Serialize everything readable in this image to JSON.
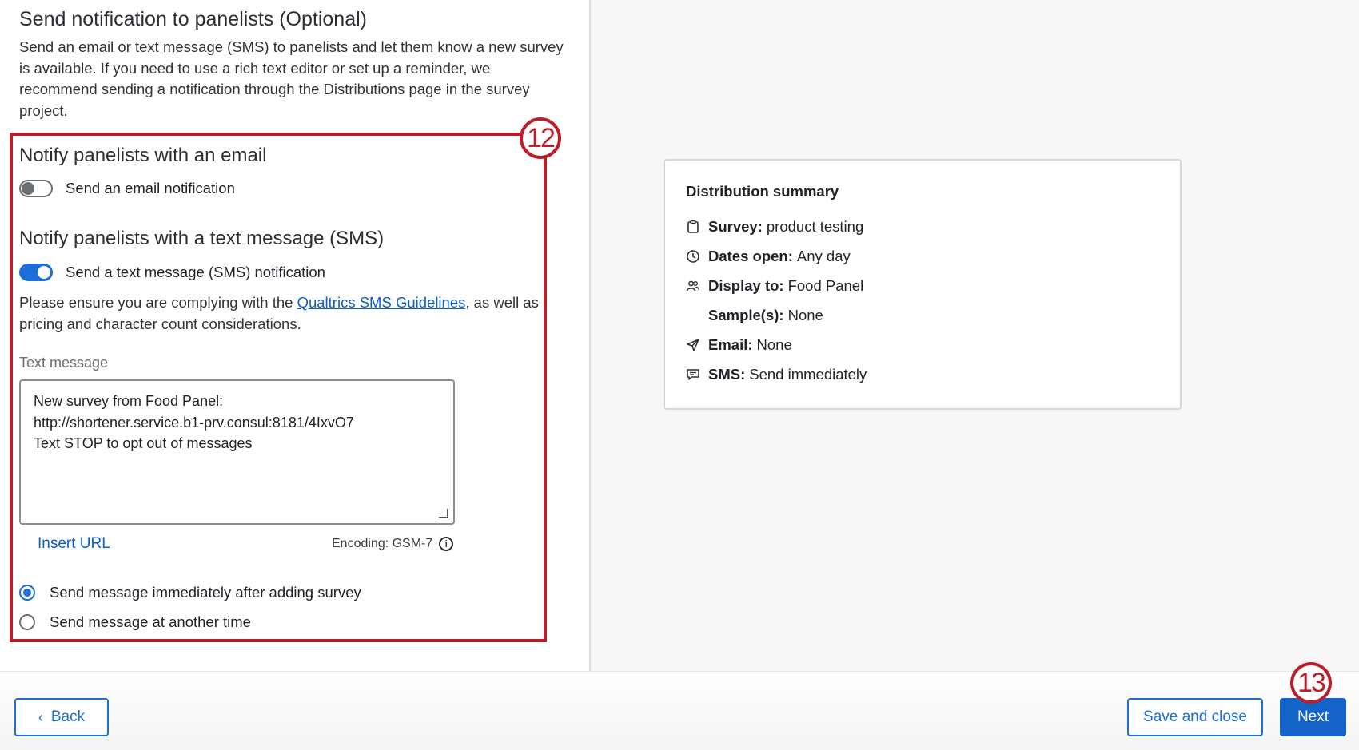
{
  "notification": {
    "title": "Send notification to panelists (Optional)",
    "description": "Send an email or text message (SMS) to panelists and let them know a new survey is available. If you need to use a rich text editor or set up a reminder, we recommend sending a notification through the Distributions page in the survey project."
  },
  "email": {
    "heading": "Notify panelists with an email",
    "toggle_label": "Send an email notification",
    "enabled": false
  },
  "sms": {
    "heading": "Notify panelists with a text message (SMS)",
    "toggle_label": "Send a text message (SMS) notification",
    "enabled": true,
    "compliance_prefix": "Please ensure you are complying with the ",
    "compliance_link": "Qualtrics SMS Guidelines",
    "compliance_suffix": ", as well as pricing and character count considerations.",
    "text_label": "Text message",
    "message_lines": [
      "New survey from Food Panel:",
      "http://shortener.service.b1-prv.consul:8181/4IxvO7",
      "Text STOP to opt out of messages"
    ],
    "insert_url": "Insert URL",
    "encoding": "Encoding: GSM-7",
    "timing_options": [
      {
        "label": "Send message immediately after adding survey",
        "selected": true
      },
      {
        "label": "Send message at another time",
        "selected": false
      }
    ]
  },
  "annotations": {
    "step_a": "12",
    "step_b": "13"
  },
  "summary": {
    "title": "Distribution summary",
    "rows": [
      {
        "icon": "clipboard-icon",
        "label": "Survey:",
        "value": "product testing"
      },
      {
        "icon": "clock-icon",
        "label": "Dates open:",
        "value": "Any day"
      },
      {
        "icon": "people-icon",
        "label": "Display to:",
        "value": "Food Panel"
      },
      {
        "icon": "",
        "label": "Sample(s):",
        "value": "None"
      },
      {
        "icon": "paper-plane-icon",
        "label": "Email:",
        "value": "None"
      },
      {
        "icon": "message-icon",
        "label": "SMS:",
        "value": "Send immediately"
      }
    ]
  },
  "footer": {
    "back": "Back",
    "save_close": "Save and close",
    "next": "Next"
  },
  "colors": {
    "accent": "#1c6fd6",
    "annotation_red": "#b9202b",
    "link": "#0b5fc7"
  }
}
